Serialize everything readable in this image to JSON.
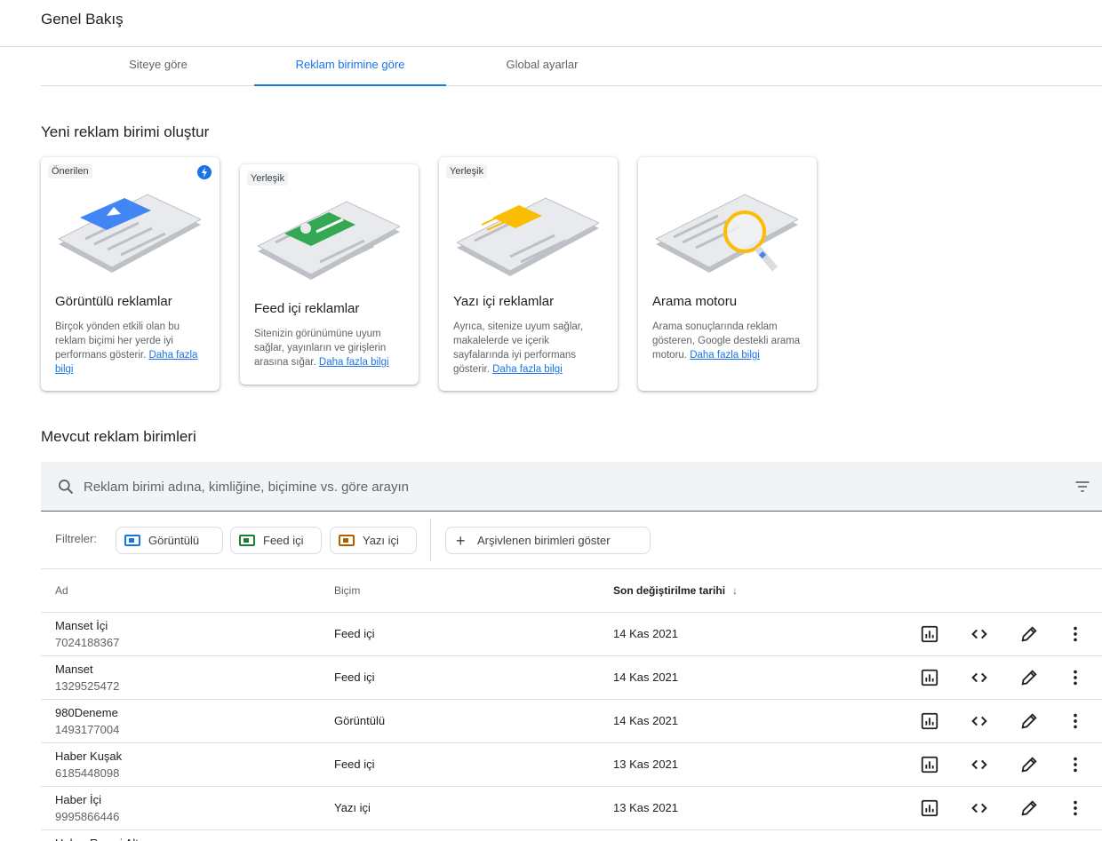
{
  "page_title": "Genel Bakış",
  "tabs": [
    {
      "label": "Siteye göre"
    },
    {
      "label": "Reklam birimine göre"
    },
    {
      "label": "Global ayarlar"
    }
  ],
  "create_section": {
    "title": "Yeni reklam birimi oluştur",
    "cards": [
      {
        "tag": "Önerilen",
        "title": "Görüntülü reklamlar",
        "desc": "Birçok yönden etkili olan bu reklam biçimi her yerde iyi performans gösterir.",
        "link": "Daha fazla bilgi",
        "color": "#4285f4"
      },
      {
        "tag": "Yerleşik",
        "title": "Feed içi reklamlar",
        "desc": "Sitenizin görünümüne uyum sağlar, yayınların ve girişlerin arasına sığar.",
        "link": "Daha fazla bilgi",
        "color": "#34a853"
      },
      {
        "tag": "Yerleşik",
        "title": "Yazı içi reklamlar",
        "desc": "Ayrıca, sitenize uyum sağlar, makalelerde ve içerik sayfalarında iyi performans gösterir.",
        "link": "Daha fazla bilgi",
        "color": "#fbbc04"
      },
      {
        "tag": "",
        "title": "Arama motoru",
        "desc": "Arama sonuçlarında reklam gösteren, Google destekli arama motoru.",
        "link": "Daha fazla bilgi",
        "color": "#fbbc04"
      }
    ]
  },
  "existing_section": {
    "title": "Mevcut reklam birimleri"
  },
  "search": {
    "placeholder": "Reklam birimi adına, kimliğine, biçimine vs. göre arayın"
  },
  "filters": {
    "label": "Filtreler:",
    "chips": [
      {
        "label": "Görüntülü",
        "color": "#1a73e8"
      },
      {
        "label": "Feed içi",
        "color": "#188038"
      },
      {
        "label": "Yazı içi",
        "color": "#b06000"
      }
    ],
    "archive_label": "Arşivlenen birimleri göster"
  },
  "table": {
    "headers": {
      "name": "Ad",
      "format": "Biçim",
      "date": "Son değiştirilme tarihi"
    },
    "rows": [
      {
        "name": "Manset İçi",
        "id": "7024188367",
        "format": "Feed içi",
        "date": "14 Kas 2021"
      },
      {
        "name": "Manset",
        "id": "1329525472",
        "format": "Feed içi",
        "date": "14 Kas 2021"
      },
      {
        "name": "980Deneme",
        "id": "1493177004",
        "format": "Görüntülü",
        "date": "14 Kas 2021"
      },
      {
        "name": "Haber Kuşak",
        "id": "6185448098",
        "format": "Feed içi",
        "date": "13 Kas 2021"
      },
      {
        "name": "Haber İçi",
        "id": "9995866446",
        "format": "Yazı içi",
        "date": "13 Kas 2021"
      },
      {
        "name": "Haber Resmi Altı",
        "id": "",
        "format": "",
        "date": ""
      }
    ]
  }
}
